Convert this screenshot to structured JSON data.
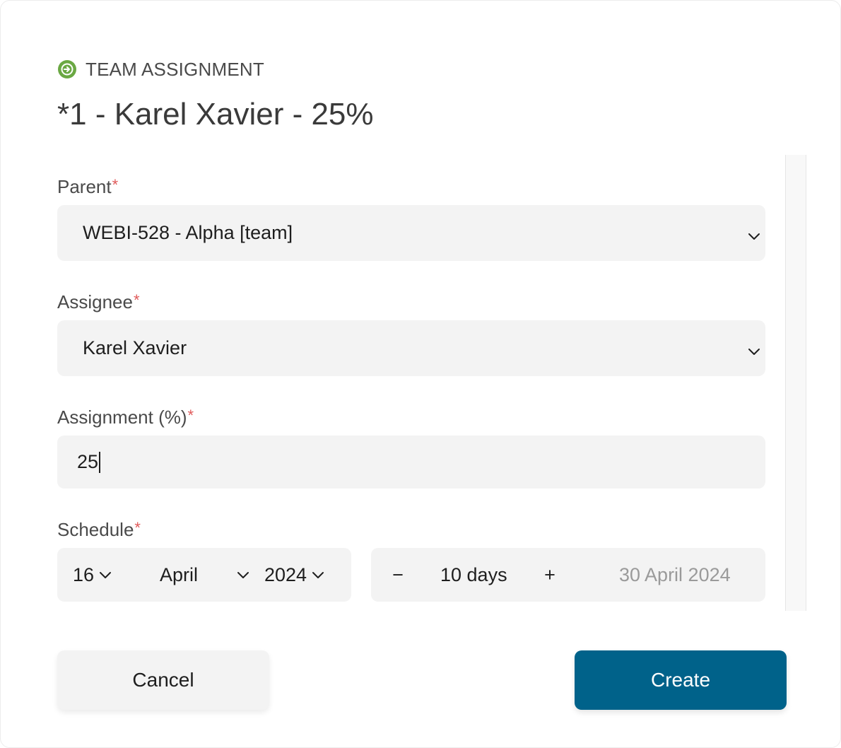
{
  "header": {
    "kicker": "TEAM ASSIGNMENT",
    "kicker_icon": "arrow-circle-right-icon",
    "title": "*1 - Karel Xavier - 25%"
  },
  "form": {
    "parent": {
      "label": "Parent",
      "required_mark": "*",
      "value": "WEBI-528 - Alpha [team]"
    },
    "assignee": {
      "label": "Assignee",
      "required_mark": "*",
      "value": "Karel Xavier"
    },
    "assignment": {
      "label": "Assignment (%)",
      "required_mark": "*",
      "value": "25"
    },
    "schedule": {
      "label": "Schedule",
      "required_mark": "*",
      "day": "16",
      "month": "April",
      "year": "2024",
      "decrement": "−",
      "duration": "10 days",
      "increment": "+",
      "end_date": "30 April 2024"
    }
  },
  "actions": {
    "cancel_label": "Cancel",
    "create_label": "Create"
  },
  "colors": {
    "primary": "#00628a",
    "required": "#e05a5a",
    "icon_green": "#6aa843",
    "field_bg": "#f3f3f3"
  }
}
